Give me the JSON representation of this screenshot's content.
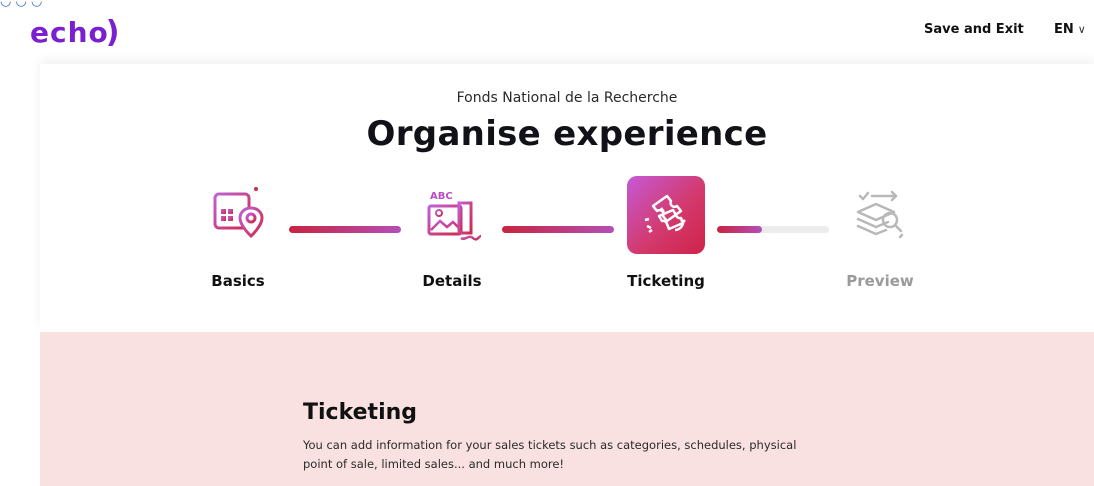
{
  "header": {
    "logo_text": "echo",
    "save_exit_label": "Save and Exit",
    "language": "EN"
  },
  "main": {
    "subtitle": "Fonds National de la Recherche",
    "title": "Organise experience"
  },
  "steps": [
    {
      "label": "Basics",
      "state": "complete",
      "icon": "calendar-location-icon"
    },
    {
      "label": "Details",
      "state": "complete",
      "icon": "image-text-icon"
    },
    {
      "label": "Ticketing",
      "state": "active",
      "icon": "tickets-icon"
    },
    {
      "label": "Preview",
      "state": "upcoming",
      "icon": "layers-search-icon"
    }
  ],
  "progress": [
    1.0,
    1.0,
    0.4
  ],
  "section": {
    "title": "Ticketing",
    "description": "You can add information for your sales tickets such as categories, schedules, physical point of sale, limited sales... and much more!"
  },
  "colors": {
    "brand": "#7a1fd1",
    "accent_start": "#c8243f",
    "accent_end": "#b34fb8",
    "section_bg": "#f9e1e1"
  }
}
